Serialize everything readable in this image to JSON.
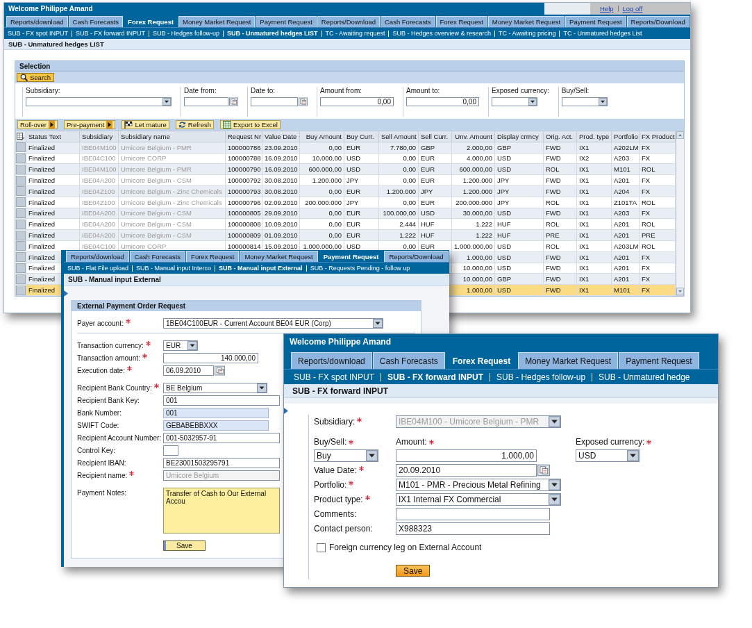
{
  "hedges_window": {
    "title": "Welcome Philippe Amand",
    "links": [
      "Help",
      "Log off"
    ],
    "tabs": [
      {
        "label": "Reports/download",
        "selected": false
      },
      {
        "label": "Cash Forecasts",
        "selected": false
      },
      {
        "label": "Forex Request",
        "selected": true
      },
      {
        "label": "Money Market Request",
        "selected": false
      },
      {
        "label": "Payment Request",
        "selected": false
      },
      {
        "label": "Reports/Download",
        "selected": false
      },
      {
        "label": "Cash Forecasts",
        "selected": false
      },
      {
        "label": "Forex Request",
        "selected": false
      },
      {
        "label": "Money Market Request",
        "selected": false
      },
      {
        "label": "Payment Request",
        "selected": false
      },
      {
        "label": "Reports/Download",
        "selected": false
      }
    ],
    "subnav": [
      {
        "label": "SUB - FX spot INPUT",
        "selected": false
      },
      {
        "label": "SUB - FX forward INPUT",
        "selected": false
      },
      {
        "label": "SUB - Hedges follow-up",
        "selected": false
      },
      {
        "label": "SUB - Unmatured hedges LIST",
        "selected": true
      },
      {
        "label": "TC - Awaiting request",
        "selected": false
      },
      {
        "label": "SUB - Hedges overview & research",
        "selected": false
      },
      {
        "label": "TC - Awaiting pricing",
        "selected": false
      },
      {
        "label": "TC - Unmatured hedges List",
        "selected": false
      }
    ],
    "page_title": "SUB - Unmatured hedges LIST",
    "selection": {
      "title": "Selection",
      "search_button": "Search",
      "filters": [
        {
          "label": "Subsidiary:",
          "kind": "select"
        },
        {
          "label": "Date from:",
          "kind": "date"
        },
        {
          "label": "Date to:",
          "kind": "date"
        },
        {
          "label": "Amount from:",
          "kind": "number",
          "value": "0,00"
        },
        {
          "label": "Amount to:",
          "kind": "number",
          "value": "0,00"
        },
        {
          "label": "Exposed currency:",
          "kind": "select"
        },
        {
          "label": "Buy/Sell:",
          "kind": "select"
        }
      ]
    },
    "toolbar": [
      {
        "label": "Roll-over",
        "kind": "menu"
      },
      {
        "label": "Pre-payment",
        "kind": "menu"
      },
      {
        "label": "Let mature",
        "kind": "action"
      },
      {
        "label": "Refresh",
        "kind": "action"
      },
      {
        "label": "Export to Excel",
        "kind": "action"
      }
    ],
    "table": {
      "columns": [
        "Status Text",
        "Subsidiary",
        "Subsidiary name",
        "Request Nr",
        "Value Date",
        "Buy Amount",
        "Buy Curr.",
        "Sell Amount",
        "Sell Curr.",
        "Unv. Amount",
        "Display crrncy",
        "Orig. Act.",
        "Prod. type",
        "Portfolio",
        "FX Product"
      ],
      "rows": [
        {
          "selected": false,
          "cells": [
            "Finalized",
            "IBE04M100",
            "Umicore Belgium - PMR",
            "100000786",
            "23.09.2010",
            "0,00",
            "EUR",
            "7.780,00",
            "GBP",
            "2.000,00",
            "GBP",
            "FWD",
            "IX1",
            "A202LM",
            "FX"
          ]
        },
        {
          "selected": false,
          "cells": [
            "Finalized",
            "IBE04C100",
            "Umicore CORP",
            "100000788",
            "16.09.2010",
            "10.000,00",
            "USD",
            "0,00",
            "EUR",
            "4.000,00",
            "USD",
            "FWD",
            "IX2",
            "A203",
            "FX"
          ]
        },
        {
          "selected": false,
          "cells": [
            "Finalized",
            "IBE04M100",
            "Umicore Belgium - PMR",
            "100000790",
            "16.09.2010",
            "600.000,00",
            "USD",
            "0,00",
            "EUR",
            "600.000,00",
            "USD",
            "ROL",
            "IX1",
            "M101",
            "ROL"
          ]
        },
        {
          "selected": false,
          "cells": [
            "Finalized",
            "IBE04A200",
            "Umicore Belgium - CSM",
            "100000792",
            "30.08.2010",
            "1.200.000",
            "JPY",
            "0,00",
            "EUR",
            "1.200.000",
            "JPY",
            "FWD",
            "IX1",
            "A201",
            "FX"
          ]
        },
        {
          "selected": false,
          "cells": [
            "Finalized",
            "IBE04Z100",
            "Umicore Belgium - Zinc Chemicals",
            "100000793",
            "30.08.2010",
            "0,00",
            "EUR",
            "1.200.000",
            "JPY",
            "1.200.000",
            "JPY",
            "FWD",
            "IX1",
            "A204",
            "FX"
          ]
        },
        {
          "selected": false,
          "cells": [
            "Finalized",
            "IBE04Z100",
            "Umicore Belgium - Zinc Chemicals",
            "100000796",
            "02.09.2010",
            "200.000.000",
            "JPY",
            "0,00",
            "EUR",
            "200.000.000",
            "JPY",
            "ROL",
            "IX1",
            "Z101TA",
            "ROL"
          ]
        },
        {
          "selected": false,
          "cells": [
            "Finalized",
            "IBE04A200",
            "Umicore Belgium - CSM",
            "100000805",
            "29.09.2010",
            "0,00",
            "EUR",
            "100.000,00",
            "USD",
            "30.000,00",
            "USD",
            "FWD",
            "IX1",
            "A203",
            "FX"
          ]
        },
        {
          "selected": false,
          "cells": [
            "Finalized",
            "IBE04A200",
            "Umicore Belgium - CSM",
            "100000808",
            "10.09.2010",
            "0,00",
            "EUR",
            "2.444",
            "HUF",
            "1.222",
            "HUF",
            "ROL",
            "IX1",
            "A201",
            "ROL"
          ]
        },
        {
          "selected": false,
          "cells": [
            "Finalized",
            "IBE04A200",
            "Umicore Belgium - CSM",
            "100000809",
            "01.09.2010",
            "0,00",
            "EUR",
            "1.222",
            "HUF",
            "1.222",
            "HUF",
            "PRE",
            "IX1",
            "A201",
            "PRE"
          ]
        },
        {
          "selected": false,
          "cells": [
            "Finalized",
            "IBE04C100",
            "Umicore CORP",
            "100000814",
            "15.09.2010",
            "1.000.000,00",
            "USD",
            "0,00",
            "EUR",
            "1.000.000,00",
            "USD",
            "ROL",
            "IX1",
            "A203LM",
            "ROL"
          ]
        },
        {
          "selected": false,
          "cells": [
            "Finalized",
            null,
            null,
            null,
            null,
            null,
            null,
            null,
            null,
            "1.000,00",
            "USD",
            "FWD",
            "IX1",
            "A201",
            "FX"
          ]
        },
        {
          "selected": false,
          "cells": [
            "Finalized",
            null,
            null,
            null,
            null,
            null,
            null,
            null,
            null,
            "10.000,00",
            "USD",
            "FWD",
            "IX1",
            "A201",
            "FX"
          ]
        },
        {
          "selected": false,
          "cells": [
            "Finalized",
            null,
            null,
            null,
            null,
            null,
            null,
            null,
            null,
            "10.000,00",
            "GBP",
            "FWD",
            "IX1",
            "A201",
            "FX"
          ]
        },
        {
          "selected": true,
          "cells": [
            "Finalized",
            null,
            null,
            null,
            null,
            null,
            null,
            null,
            null,
            "1.000,00",
            "USD",
            "FWD",
            "IX1",
            "M101",
            "FX"
          ]
        }
      ]
    }
  },
  "payment_window": {
    "tabs": [
      {
        "label": "Reports/download",
        "selected": false
      },
      {
        "label": "Cash Forecasts",
        "selected": false
      },
      {
        "label": "Forex Request",
        "selected": false
      },
      {
        "label": "Money Market Request",
        "selected": false
      },
      {
        "label": "Payment Request",
        "selected": true
      },
      {
        "label": "Reports/Download",
        "selected": false
      }
    ],
    "subnav": [
      {
        "label": "SUB - Flat File upload",
        "selected": false
      },
      {
        "label": "SUB - Manual input Interco",
        "selected": false
      },
      {
        "label": "SUB - Manual input External",
        "selected": true
      },
      {
        "label": "SUB - Requests Pending - follow up",
        "selected": false
      }
    ],
    "page_title": "SUB - Manual input External",
    "form": {
      "title": "External Payment Order Request",
      "groups": [
        {
          "fields": [
            {
              "label": "Payer account:",
              "required": true,
              "kind": "select",
              "disabled": false,
              "value": "1BE04C100EUR - Current Account BE04 EUR (Corp)"
            }
          ]
        },
        {
          "fields": [
            {
              "label": "Transaction currency:",
              "required": true,
              "kind": "select",
              "disabled": false,
              "value": "EUR"
            },
            {
              "label": "Transaction amount:",
              "required": true,
              "kind": "number",
              "disabled": false,
              "value": "140.000,00"
            },
            {
              "label": "Execution date:",
              "required": true,
              "kind": "date",
              "disabled": false,
              "value": "06.09.2010"
            }
          ]
        },
        {
          "fields": [
            {
              "label": "Recipient Bank Country:",
              "required": true,
              "kind": "select",
              "disabled": false,
              "value": "BE Belgium"
            },
            {
              "label": "Recipient Bank Key:",
              "required": false,
              "kind": "text",
              "disabled": false,
              "value": "001"
            },
            {
              "label": "Bank Number:",
              "required": false,
              "kind": "readonly",
              "disabled": false,
              "value": "001"
            },
            {
              "label": "SWIFT Code:",
              "required": false,
              "kind": "readonly",
              "disabled": false,
              "value": "GEBABEBBXXX"
            },
            {
              "label": "Recipient Account Number:",
              "required": false,
              "kind": "text",
              "disabled": false,
              "value": "001-5032957-91"
            },
            {
              "label": "Control Key:",
              "required": false,
              "kind": "text",
              "disabled": false
            },
            {
              "label": "Recipient IBAN:",
              "required": false,
              "kind": "text",
              "disabled": false,
              "value": "BE23001503295791"
            },
            {
              "label": "Recipient name:",
              "required": true,
              "kind": "text",
              "disabled": true,
              "value": "Umicore Belgium"
            }
          ]
        },
        {
          "fields": [
            {
              "label": "Payment Notes:",
              "required": false,
              "kind": "textarea",
              "disabled": false,
              "value": "Transfer of Cash to Our External Accou"
            }
          ]
        }
      ],
      "save_button": "Save"
    }
  },
  "fx_forward_window": {
    "title": "Welcome Philippe Amand",
    "tabs": [
      {
        "label": "Reports/download",
        "selected": false
      },
      {
        "label": "Cash Forecasts",
        "selected": false
      },
      {
        "label": "Forex Request",
        "selected": true
      },
      {
        "label": "Money Market Request",
        "selected": false
      },
      {
        "label": "Payment Request",
        "selected": false
      }
    ],
    "subnav": [
      {
        "label": "SUB - FX spot INPUT",
        "selected": false
      },
      {
        "label": "SUB - FX forward INPUT",
        "selected": true
      },
      {
        "label": "SUB - Hedges follow-up",
        "selected": false
      },
      {
        "label": "SUB - Unmatured hedge",
        "selected": false
      }
    ],
    "page_title": "SUB - FX forward INPUT",
    "fields": [
      {
        "label": "Subsidiary:",
        "required": true,
        "kind": "select",
        "disabled": true,
        "value": "IBE04M100 - Umicore Belgium - PMR"
      },
      {
        "label": "Buy/Sell:",
        "required": true,
        "kind": "select",
        "disabled": false,
        "value": "Buy"
      },
      {
        "label": "Amount:",
        "required": true,
        "kind": "number",
        "disabled": false,
        "value": "1.000,00"
      },
      {
        "label": "Exposed currency:",
        "required": true,
        "kind": "select",
        "disabled": false,
        "value": "USD"
      },
      {
        "label": "Value Date:",
        "required": true,
        "kind": "date",
        "disabled": false,
        "value": "20.09.2010"
      },
      {
        "label": "Portfolio:",
        "required": true,
        "kind": "select",
        "disabled": false,
        "value": "M101 - PMR - Precious Metal Refining"
      },
      {
        "label": "Product type:",
        "required": true,
        "kind": "select",
        "disabled": false,
        "value": "IX1 Internal FX Commercial"
      },
      {
        "label": "Comments:",
        "required": false,
        "kind": "text",
        "disabled": false
      },
      {
        "label": "Contact person:",
        "required": false,
        "kind": "text",
        "disabled": false,
        "value": "X988323"
      }
    ],
    "checkbox": {
      "label": "Foreign currency leg on External Account",
      "checked": false
    },
    "save_button": "Save"
  }
}
